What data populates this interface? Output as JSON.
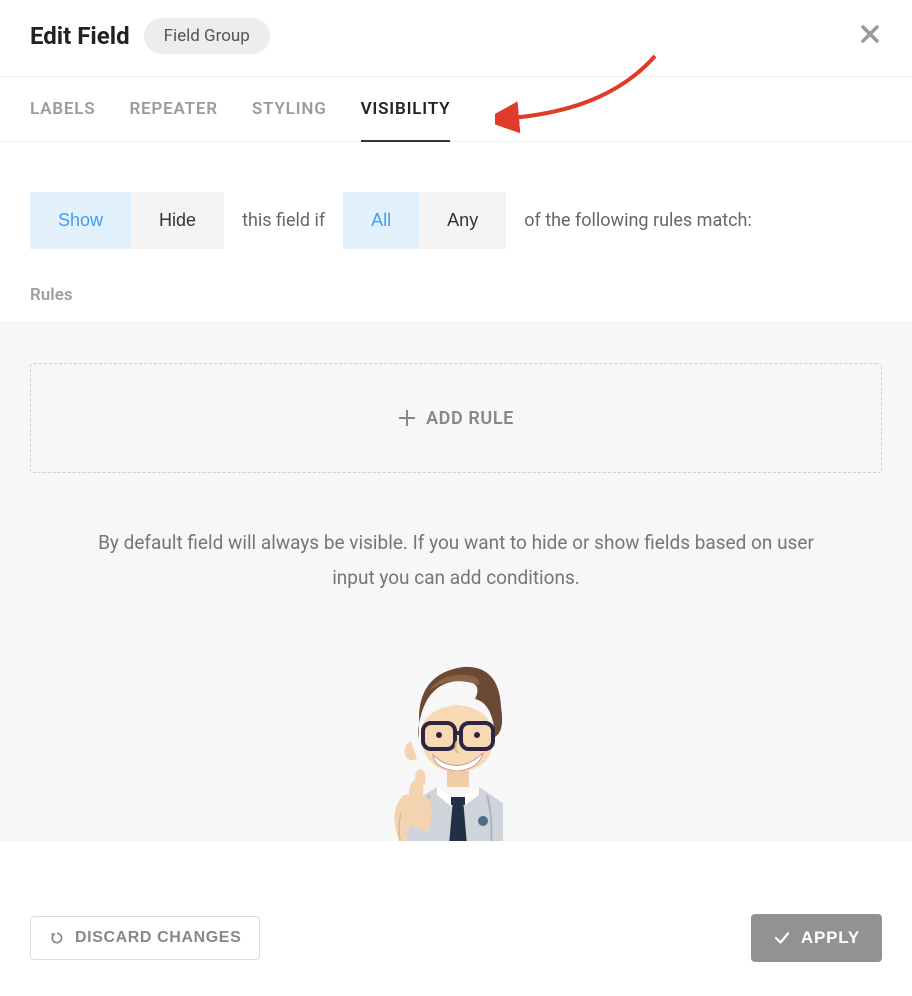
{
  "header": {
    "title": "Edit Field",
    "badge": "Field Group"
  },
  "tabs": [
    {
      "label": "LABELS",
      "active": false
    },
    {
      "label": "REPEATER",
      "active": false
    },
    {
      "label": "STYLING",
      "active": false
    },
    {
      "label": "VISIBILITY",
      "active": true
    }
  ],
  "condition": {
    "show_label": "Show",
    "hide_label": "Hide",
    "text1": "this field if",
    "all_label": "All",
    "any_label": "Any",
    "text2": "of the following rules match:"
  },
  "rules": {
    "section_label": "Rules",
    "add_rule_label": "ADD RULE",
    "help_text": "By default field will always be visible. If you want to hide or show fields based on user input you can add conditions."
  },
  "footer": {
    "discard_label": "DISCARD CHANGES",
    "apply_label": "APPLY"
  }
}
